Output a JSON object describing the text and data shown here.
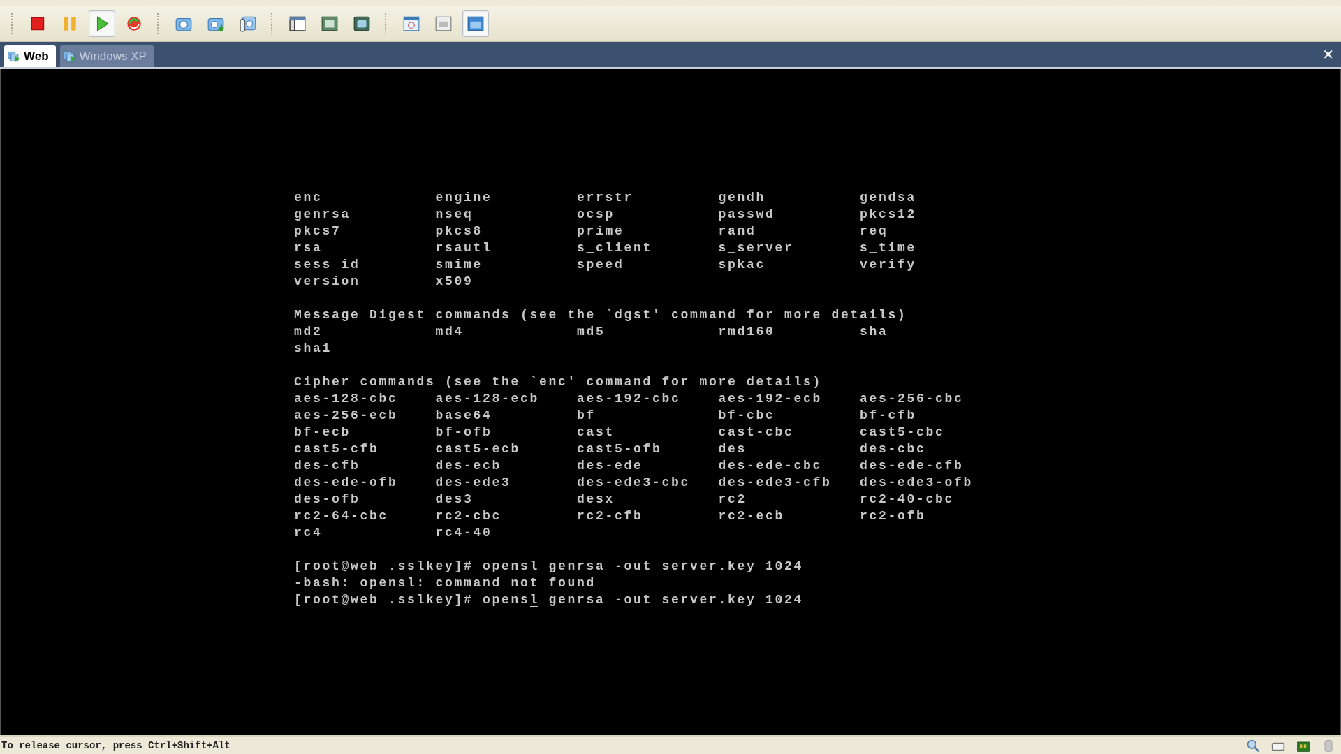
{
  "toolbar": {
    "groups": [
      [
        {
          "kind": "stop",
          "pressed": false
        },
        {
          "kind": "pause",
          "pressed": false
        },
        {
          "kind": "play",
          "pressed": true
        },
        {
          "kind": "reset",
          "pressed": false
        }
      ],
      [
        {
          "kind": "snapshot",
          "pressed": false
        },
        {
          "kind": "revert",
          "pressed": false
        },
        {
          "kind": "manager",
          "pressed": false
        }
      ],
      [
        {
          "kind": "sidebar",
          "pressed": false
        },
        {
          "kind": "fullscreen",
          "pressed": false
        },
        {
          "kind": "fit",
          "pressed": false
        }
      ],
      [
        {
          "kind": "window",
          "pressed": false
        },
        {
          "kind": "console",
          "pressed": false
        },
        {
          "kind": "unity",
          "pressed": true
        }
      ]
    ]
  },
  "tabs": [
    {
      "label": "Web",
      "selected": true
    },
    {
      "label": "Windows XP",
      "selected": false
    }
  ],
  "close": "✕",
  "terminal": {
    "lines": [
      {
        "kind": "columns",
        "cells": [
          "enc",
          "engine",
          "errstr",
          "gendh",
          "gendsa"
        ]
      },
      {
        "kind": "columns",
        "cells": [
          "genrsa",
          "nseq",
          "ocsp",
          "passwd",
          "pkcs12"
        ]
      },
      {
        "kind": "columns",
        "cells": [
          "pkcs7",
          "pkcs8",
          "prime",
          "rand",
          "req"
        ]
      },
      {
        "kind": "columns",
        "cells": [
          "rsa",
          "rsautl",
          "s_client",
          "s_server",
          "s_time"
        ]
      },
      {
        "kind": "columns",
        "cells": [
          "sess_id",
          "smime",
          "speed",
          "spkac",
          "verify"
        ]
      },
      {
        "kind": "columns",
        "cells": [
          "version",
          "x509"
        ]
      },
      {
        "kind": "blank"
      },
      {
        "kind": "text",
        "text": "Message Digest commands (see the `dgst' command for more details)"
      },
      {
        "kind": "columns",
        "cells": [
          "md2",
          "md4",
          "md5",
          "rmd160",
          "sha"
        ]
      },
      {
        "kind": "columns",
        "cells": [
          "sha1"
        ]
      },
      {
        "kind": "blank"
      },
      {
        "kind": "text",
        "text": "Cipher commands (see the `enc' command for more details)"
      },
      {
        "kind": "columns",
        "cells": [
          "aes-128-cbc",
          "aes-128-ecb",
          "aes-192-cbc",
          "aes-192-ecb",
          "aes-256-cbc"
        ]
      },
      {
        "kind": "columns",
        "cells": [
          "aes-256-ecb",
          "base64",
          "bf",
          "bf-cbc",
          "bf-cfb"
        ]
      },
      {
        "kind": "columns",
        "cells": [
          "bf-ecb",
          "bf-ofb",
          "cast",
          "cast-cbc",
          "cast5-cbc"
        ]
      },
      {
        "kind": "columns",
        "cells": [
          "cast5-cfb",
          "cast5-ecb",
          "cast5-ofb",
          "des",
          "des-cbc"
        ]
      },
      {
        "kind": "columns",
        "cells": [
          "des-cfb",
          "des-ecb",
          "des-ede",
          "des-ede-cbc",
          "des-ede-cfb"
        ]
      },
      {
        "kind": "columns",
        "cells": [
          "des-ede-ofb",
          "des-ede3",
          "des-ede3-cbc",
          "des-ede3-cfb",
          "des-ede3-ofb"
        ]
      },
      {
        "kind": "columns",
        "cells": [
          "des-ofb",
          "des3",
          "desx",
          "rc2",
          "rc2-40-cbc"
        ]
      },
      {
        "kind": "columns",
        "cells": [
          "rc2-64-cbc",
          "rc2-cbc",
          "rc2-cfb",
          "rc2-ecb",
          "rc2-ofb"
        ]
      },
      {
        "kind": "columns",
        "cells": [
          "rc4",
          "rc4-40"
        ]
      },
      {
        "kind": "blank"
      },
      {
        "kind": "text",
        "text": "[root@web .sslkey]# opensl genrsa -out server.key 1024"
      },
      {
        "kind": "text",
        "text": "-bash: opensl: command not found"
      },
      {
        "kind": "cursor",
        "before": "[root@web .sslkey]# opens",
        "at": "l",
        "after": " genrsa -out server.key 1024"
      }
    ]
  },
  "status_bar": {
    "text": "To release cursor, press Ctrl+Shift+Alt"
  }
}
